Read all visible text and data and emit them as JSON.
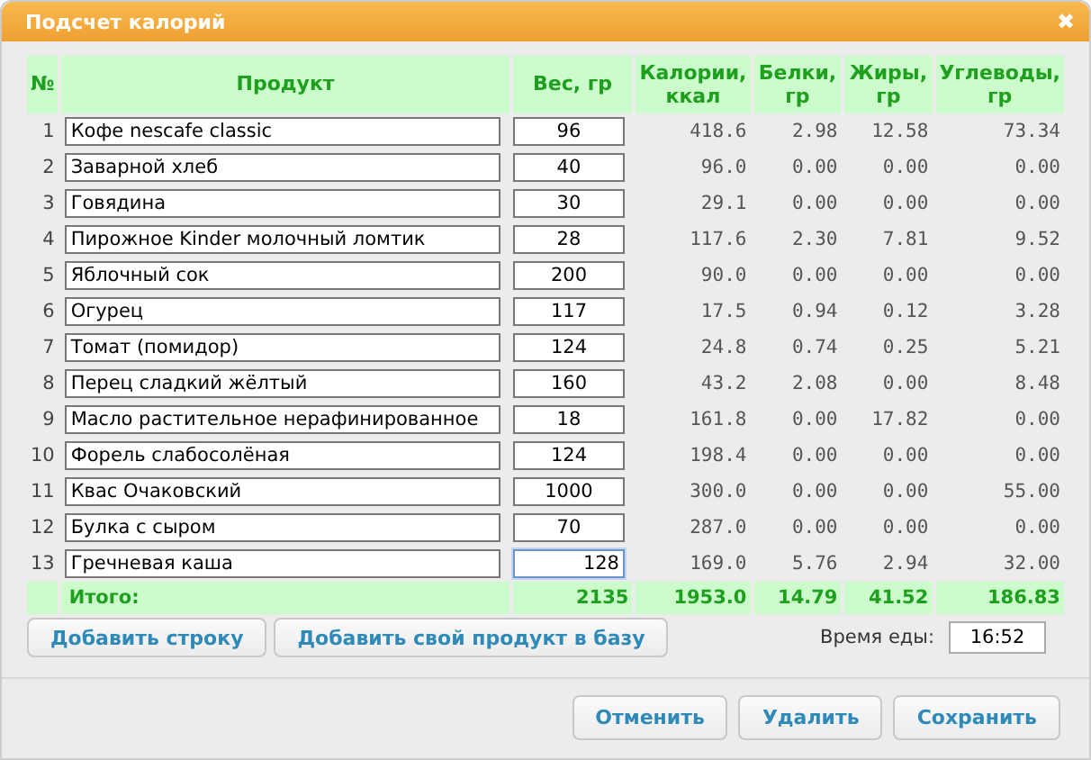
{
  "window": {
    "title": "Подсчет калорий",
    "close": "✖"
  },
  "table": {
    "columns": [
      "№",
      "Продукт",
      "Вес, гр",
      "Калории, ккал",
      "Белки, гр",
      "Жиры, гр",
      "Углеводы, гр"
    ],
    "rows": [
      {
        "n": "1",
        "product": "Кофе nescafe classic",
        "weight": "96",
        "focused": false,
        "kcal": "418.6",
        "protein": "2.98",
        "fat": "12.58",
        "carbs": "73.34"
      },
      {
        "n": "2",
        "product": "Заварной хлеб",
        "weight": "40",
        "focused": false,
        "kcal": "96.0",
        "protein": "0.00",
        "fat": "0.00",
        "carbs": "0.00"
      },
      {
        "n": "3",
        "product": "Говядина",
        "weight": "30",
        "focused": false,
        "kcal": "29.1",
        "protein": "0.00",
        "fat": "0.00",
        "carbs": "0.00"
      },
      {
        "n": "4",
        "product": "Пирожное Kinder молочный ломтик",
        "weight": "28",
        "focused": false,
        "kcal": "117.6",
        "protein": "2.30",
        "fat": "7.81",
        "carbs": "9.52"
      },
      {
        "n": "5",
        "product": "Яблочный сок",
        "weight": "200",
        "focused": false,
        "kcal": "90.0",
        "protein": "0.00",
        "fat": "0.00",
        "carbs": "0.00"
      },
      {
        "n": "6",
        "product": "Огурец",
        "weight": "117",
        "focused": false,
        "kcal": "17.5",
        "protein": "0.94",
        "fat": "0.12",
        "carbs": "3.28"
      },
      {
        "n": "7",
        "product": "Томат (помидор)",
        "weight": "124",
        "focused": false,
        "kcal": "24.8",
        "protein": "0.74",
        "fat": "0.25",
        "carbs": "5.21"
      },
      {
        "n": "8",
        "product": "Перец сладкий жёлтый",
        "weight": "160",
        "focused": false,
        "kcal": "43.2",
        "protein": "2.08",
        "fat": "0.00",
        "carbs": "8.48"
      },
      {
        "n": "9",
        "product": "Масло растительное нерафинированное",
        "weight": "18",
        "focused": false,
        "kcal": "161.8",
        "protein": "0.00",
        "fat": "17.82",
        "carbs": "0.00"
      },
      {
        "n": "10",
        "product": "Форель слабосолёная",
        "weight": "124",
        "focused": false,
        "kcal": "198.4",
        "protein": "0.00",
        "fat": "0.00",
        "carbs": "0.00"
      },
      {
        "n": "11",
        "product": "Квас Очаковский",
        "weight": "1000",
        "focused": false,
        "kcal": "300.0",
        "protein": "0.00",
        "fat": "0.00",
        "carbs": "55.00"
      },
      {
        "n": "12",
        "product": "Булка с сыром",
        "weight": "70",
        "focused": false,
        "kcal": "287.0",
        "protein": "0.00",
        "fat": "0.00",
        "carbs": "0.00"
      },
      {
        "n": "13",
        "product": "Гречневая каша",
        "weight": "128",
        "focused": true,
        "kcal": "169.0",
        "protein": "5.76",
        "fat": "2.94",
        "carbs": "32.00"
      }
    ],
    "total": {
      "label": "Итого:",
      "weight": "2135",
      "kcal": "1953.0",
      "protein": "14.79",
      "fat": "41.52",
      "carbs": "186.83"
    }
  },
  "actions": [
    "Добавить строку",
    "Добавить свой продукт в базу"
  ],
  "meal_time": {
    "label": "Время еды:",
    "value": "16:52"
  },
  "buttons": [
    "Отменить",
    "Удалить",
    "Сохранить"
  ]
}
